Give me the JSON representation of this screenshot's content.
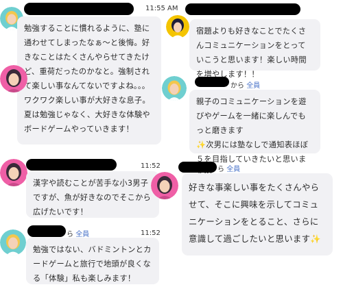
{
  "chat": {
    "colors": {
      "bubble_bg": "#f1f1f4",
      "to_all": "#4a73c8",
      "redaction": "#000000"
    },
    "messages": [
      {
        "id": "m1",
        "avatar": "blonde-woman-avatar",
        "time": "11:55 AM",
        "text": "勉強することに慣れるように、塾に通わせてしまったなぁ～と後悔。好きなことはたくさんやらせてきたけど、重荷だったのかなと。強制されて楽しい事なんてないですよね。。。ワクワク楽しい事が大好きな息子。夏は勉強じゃなく、大好きな体験やボードゲームやっていきます！"
      },
      {
        "id": "m2",
        "avatar": "pink-haired-woman-avatar",
        "time": "11:52",
        "text": "漢字や読むことが苦手な小3男子ですが、魚が好きなのでそこから広げたいです！"
      },
      {
        "id": "m3",
        "avatar": "blonde-woman-avatar",
        "meta_suffix": "ら",
        "to_label": "全員",
        "time": "11:52",
        "text": "勉強ではない、バドミントンとカードゲームと旅行で地頭が良くなる「体験」私も楽しみます！"
      },
      {
        "id": "m4",
        "avatar": "dark-haired-woman-avatar",
        "text": "宿題よりも好きなことでたくさんコミュニケーションをとっていこうと思います！楽しい時間を増やします！！"
      },
      {
        "id": "m5",
        "avatar": "blonde-woman-avatar",
        "meta_suffix": "から",
        "to_label": "全員",
        "text_before": "親子のコミュニケーションを遊びやゲームを一緒に楽しんでもっと磨きます",
        "sparkle": "✨",
        "text_after": "次男には塾なしで通知表ほぼ５を目指していきたいと思います～"
      },
      {
        "id": "m6",
        "avatar": "pink-haired-woman-avatar",
        "meta_suffix": "ら",
        "to_label": "全員",
        "text": "好きな事楽しい事をたくさんやらせて、そこに興味を示してコミュニケーションをとること、さらに意識して過ごしたいと思います",
        "sparkle": "✨"
      }
    ]
  }
}
